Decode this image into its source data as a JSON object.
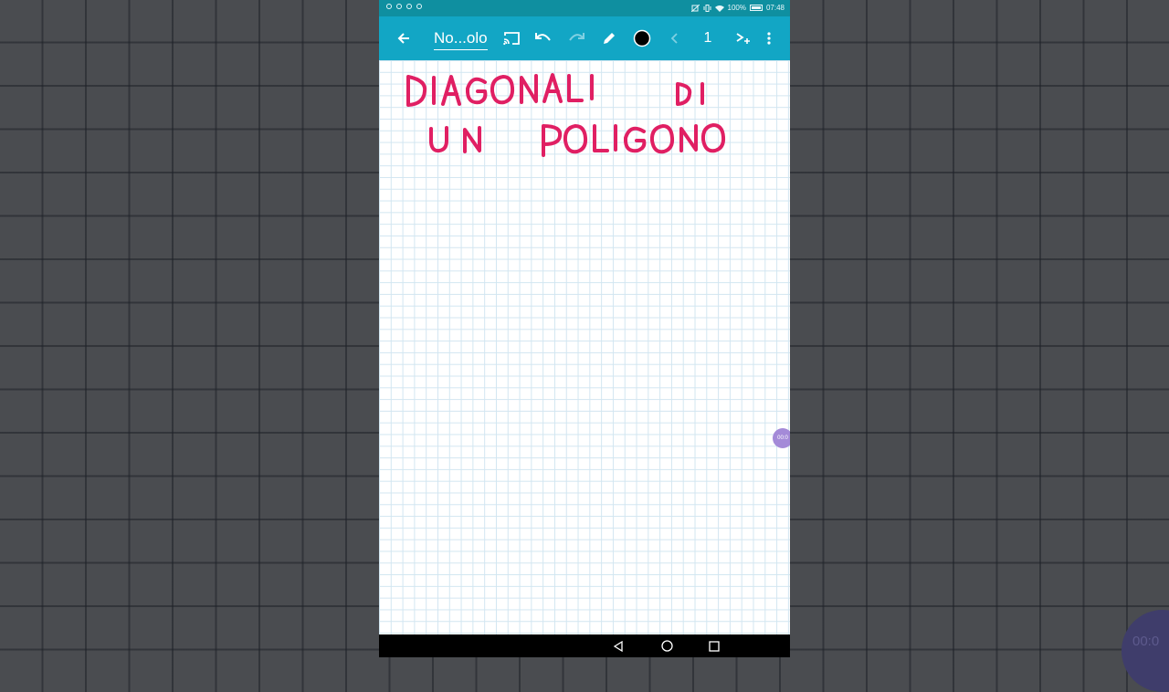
{
  "status_bar": {
    "battery": "100%",
    "time": "07:48"
  },
  "toolbar": {
    "back_icon": "arrow-left-icon",
    "title": "No...olo",
    "cast_icon": "cast-icon",
    "undo_icon": "undo-icon",
    "redo_icon": "redo-icon",
    "pen_icon": "pencil-icon",
    "color": "#000000",
    "prev_icon": "chevron-left-icon",
    "page": "1",
    "add_page_icon": "add-page-icon",
    "menu_icon": "more-vertical-icon"
  },
  "canvas": {
    "handwritten_lines": [
      "DIAGONALI DI",
      "UN POLIGONO"
    ],
    "ink_color": "#e01f63",
    "grid_color": "#d2e6f1"
  },
  "recording_bubble": "00:0",
  "corner_bubble": "00:0",
  "colors": {
    "toolbar": "#12a6c5",
    "status_bar": "#0f8fa0",
    "nav_bar": "#000000"
  }
}
